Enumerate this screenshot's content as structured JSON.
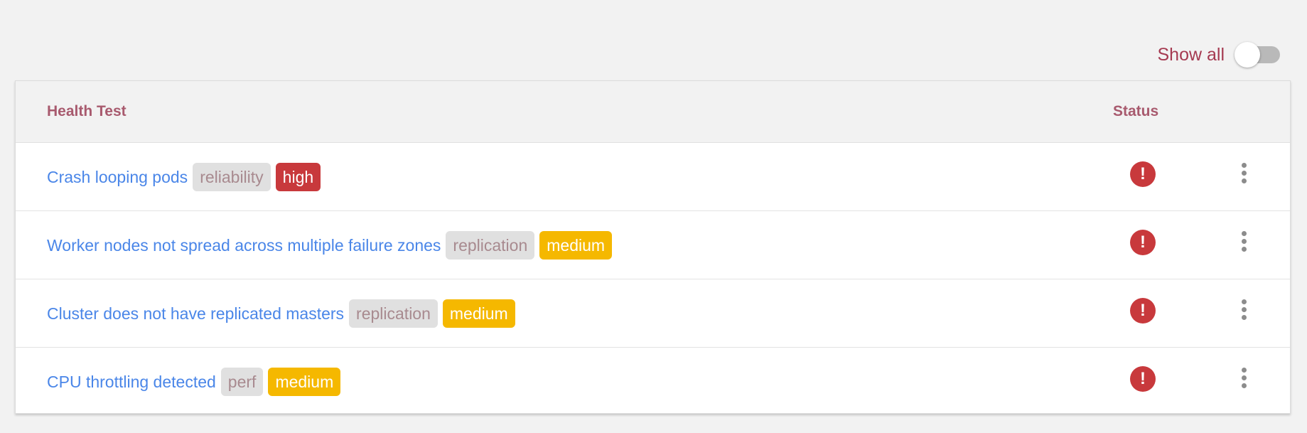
{
  "toolbar": {
    "show_all_label": "Show all",
    "show_all_checked": false
  },
  "table": {
    "columns": {
      "health_test": "Health Test",
      "status": "Status"
    },
    "rows": [
      {
        "name": "Crash looping pods",
        "category": "reliability",
        "severity": "high",
        "status_icon": "alert-circle-icon"
      },
      {
        "name": "Worker nodes not spread across multiple failure zones",
        "category": "replication",
        "severity": "medium",
        "status_icon": "alert-circle-icon"
      },
      {
        "name": "Cluster does not have replicated masters",
        "category": "replication",
        "severity": "medium",
        "status_icon": "alert-circle-icon"
      },
      {
        "name": "CPU throttling detected",
        "category": "perf",
        "severity": "medium",
        "status_icon": "alert-circle-icon"
      }
    ]
  },
  "colors": {
    "link": "#4a86e8",
    "accent": "#a53a51",
    "severity_high": "#c8393c",
    "severity_medium": "#f5b800",
    "status_error": "#c8393c"
  }
}
